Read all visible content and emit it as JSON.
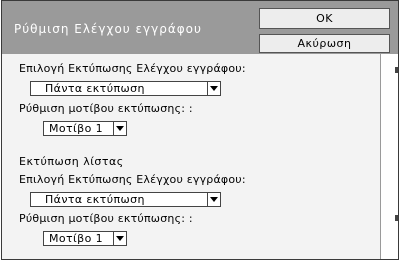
{
  "dialog": {
    "title": "Ρύθμιση Ελέγχου εγγράφου",
    "ok_label": "OK",
    "cancel_label": "Ακύρωση"
  },
  "section1": {
    "print_select_label": "Επιλογή Εκτύπωσης Ελέγχου εγγράφου:",
    "print_select_value": "Πάντα εκτύπωση",
    "pattern_label": "Ρύθμιση μοτίβου εκτύπωσης: :",
    "pattern_value": "Μοτίβο 1"
  },
  "section2": {
    "heading": "Εκτύπωση λίστας",
    "print_select_label": "Επιλογή Εκτύπωσης Ελέγχου εγγράφου:",
    "print_select_value": "Πάντα εκτύπωση",
    "pattern_label": "Ρύθμιση μοτίβου εκτύπωσης: :",
    "pattern_value": "Μοτίβο 1"
  },
  "icons": {
    "dropdown": "chevron-down-icon"
  },
  "colors": {
    "titlebar": "#9a9a9a",
    "content_bg": "#f3f3f3",
    "button_bg": "#ededed"
  }
}
